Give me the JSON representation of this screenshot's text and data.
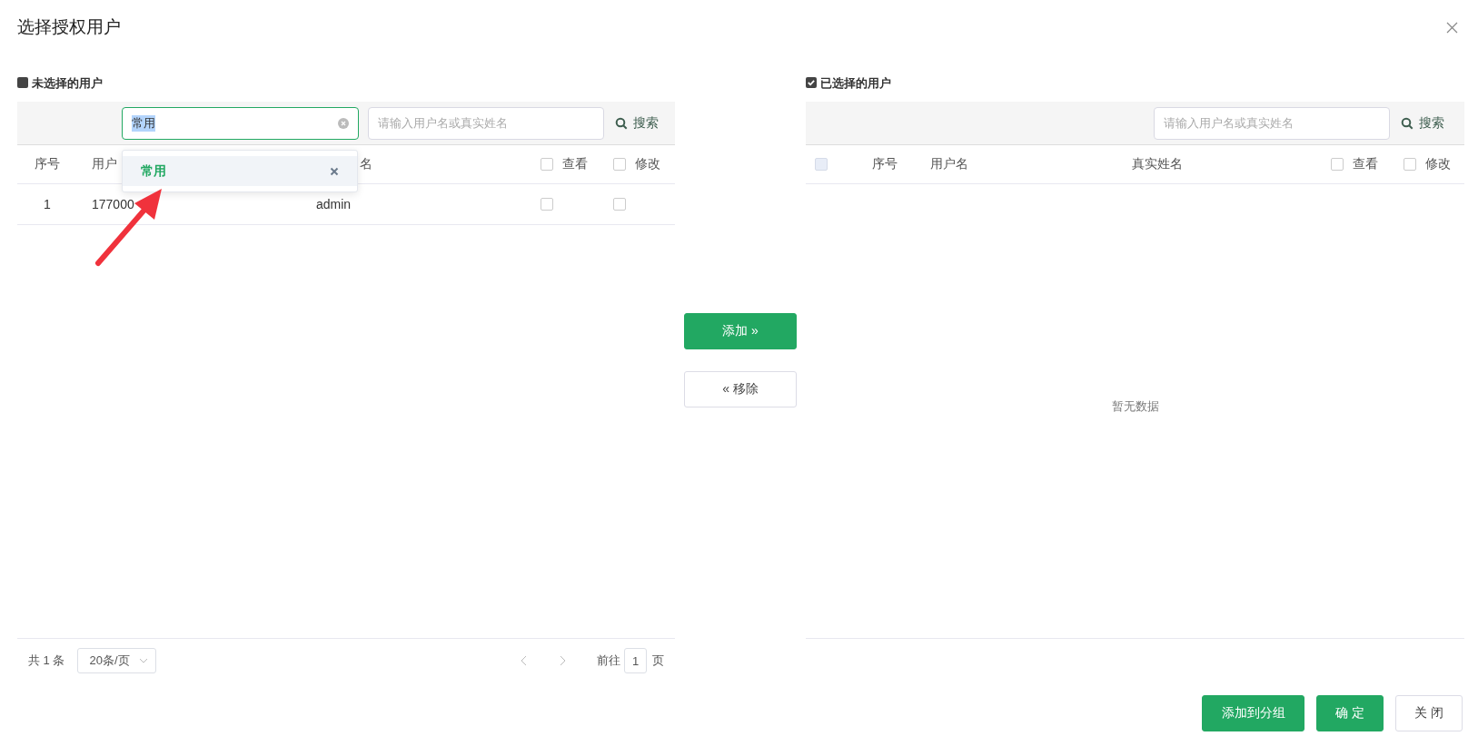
{
  "dialog": {
    "title": "选择授权用户"
  },
  "left_panel": {
    "heading": "未选择的用户",
    "checked": false,
    "tag_input": {
      "value": "常用",
      "text_selected": true
    },
    "search": {
      "placeholder": "请输入用户名或真实姓名"
    },
    "search_button": "搜索",
    "columns": [
      {
        "label": "序号",
        "kind": "text"
      },
      {
        "label": "用户",
        "kind": "text"
      },
      {
        "label": "名",
        "kind": "covered"
      },
      {
        "label": "查看",
        "kind": "check",
        "checked": false
      },
      {
        "label": "修改",
        "kind": "check",
        "checked": false
      }
    ],
    "rows": [
      {
        "index": "1",
        "username": "177000",
        "real_name": "admin",
        "view": false,
        "edit": false
      }
    ],
    "dropdown": [
      {
        "label": "常用",
        "selected": true
      }
    ],
    "pagination": {
      "total": "共 1 条",
      "page_size": "20条/页",
      "goto_label": "前往",
      "page": "1",
      "page_suffix": "页"
    }
  },
  "transfer_buttons": [
    {
      "label": "添加 »",
      "kind": "primary"
    },
    {
      "label": "« 移除",
      "kind": "default"
    }
  ],
  "right_panel": {
    "heading": "已选择的用户",
    "checked": true,
    "select_all": {
      "disabled": true
    },
    "search": {
      "placeholder": "请输入用户名或真实姓名"
    },
    "search_button": "搜索",
    "columns": [
      {
        "label": "序号",
        "kind": "text"
      },
      {
        "label": "用户名",
        "kind": "text"
      },
      {
        "label": "真实姓名",
        "kind": "text"
      },
      {
        "label": "查看",
        "kind": "check",
        "checked": false
      },
      {
        "label": "修改",
        "kind": "check",
        "checked": false
      }
    ],
    "empty_text": "暂无数据"
  },
  "footer_buttons": [
    {
      "label": "添加到分组",
      "kind": "primary"
    },
    {
      "label": "确 定",
      "kind": "primary"
    },
    {
      "label": "关 闭",
      "kind": "default"
    }
  ]
}
